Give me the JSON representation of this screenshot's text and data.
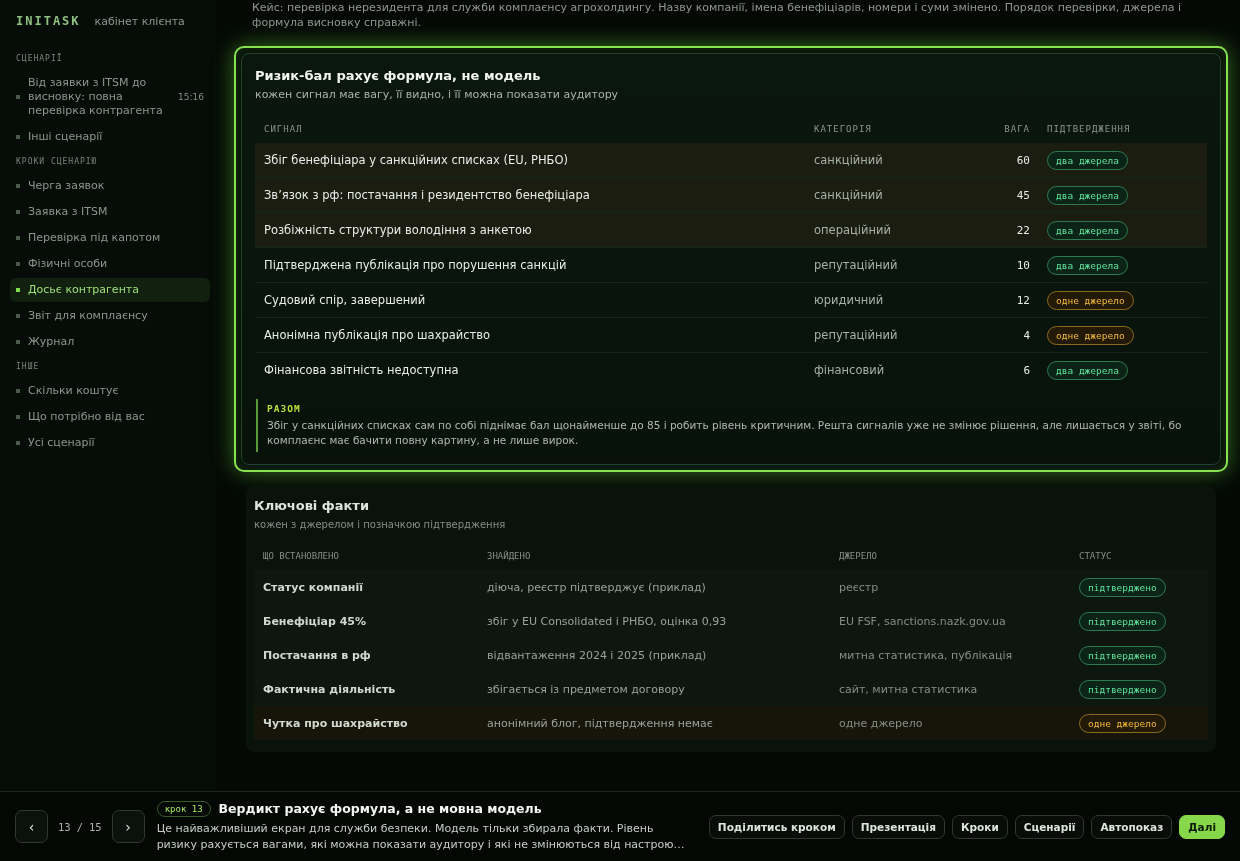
{
  "sidebar": {
    "logo": "INITASK",
    "subtitle": "кабінет клієнта",
    "sections": [
      {
        "title": "СЦЕНАРІЇ",
        "items": [
          {
            "label": "Від заявки з ITSM до висновку: повна перевірка контрагента",
            "badge": "15:16",
            "selected": false
          },
          {
            "label": "Інші сценарії",
            "selected": false
          }
        ]
      },
      {
        "title": "КРОКИ СЦЕНАРІЮ",
        "items": [
          {
            "label": "Черга заявок",
            "selected": false
          },
          {
            "label": "Заявка з ITSM",
            "selected": false
          },
          {
            "label": "Перевірка під капотом",
            "selected": false
          },
          {
            "label": "Фізичні особи",
            "selected": false
          },
          {
            "label": "Досьє контрагента",
            "selected": true
          },
          {
            "label": "Звіт для комплаєнсу",
            "selected": false
          },
          {
            "label": "Журнал",
            "selected": false
          }
        ]
      },
      {
        "title": "ІНШЕ",
        "items": [
          {
            "label": "Скільки коштує",
            "selected": false
          },
          {
            "label": "Що потрібно від вас",
            "selected": false
          },
          {
            "label": "Усі сценарії",
            "selected": false
          }
        ]
      }
    ]
  },
  "intro": "Кейс: перевірка нерезидента для служби комплаєнсу агрохолдингу. Назву компанії, імена бенефіціарів, номери і суми змінено. Порядок перевірки, джерела і формула висновку справжні.",
  "risk_card": {
    "title": "Ризик-бал рахує формула, не модель",
    "subtitle": "кожен сигнал має вагу, її видно, і її можна показати аудитору",
    "columns": [
      "СИГНАЛ",
      "КАТЕГОРІЯ",
      "ВАГА",
      "ПІДТВЕРДЖЕННЯ"
    ],
    "rows": [
      {
        "signal": "Збіг бенефіціара у санкційних списках (EU, РНБО)",
        "category": "санкційний",
        "weight": "60",
        "confirmation": "два джерела",
        "kind": "double",
        "highlighted": true
      },
      {
        "signal": "Зв’язок з рф: постачання і резидентство бенефіціара",
        "category": "санкційний",
        "weight": "45",
        "confirmation": "два джерела",
        "kind": "double",
        "highlighted": true
      },
      {
        "signal": "Розбіжність структури володіння з анкетою",
        "category": "операційний",
        "weight": "22",
        "confirmation": "два джерела",
        "kind": "double",
        "highlighted": true
      },
      {
        "signal": "Підтверджена публікація про порушення санкцій",
        "category": "репутаційний",
        "weight": "10",
        "confirmation": "два джерела",
        "kind": "double",
        "highlighted": false
      },
      {
        "signal": "Судовий спір, завершений",
        "category": "юридичний",
        "weight": "12",
        "confirmation": "одне джерело",
        "kind": "single",
        "highlighted": false
      },
      {
        "signal": "Анонімна публікація про шахрайство",
        "category": "репутаційний",
        "weight": "4",
        "confirmation": "одне джерело",
        "kind": "single",
        "highlighted": false
      },
      {
        "signal": "Фінансова звітність недоступна",
        "category": "фінансовий",
        "weight": "6",
        "confirmation": "два джерела",
        "kind": "double",
        "highlighted": false
      }
    ],
    "summary_label": "РАЗОМ",
    "summary": "Збіг у санкційних списках сам по собі піднімає бал щонайменше до 85 і робить рівень критичним. Решта сигналів уже не змінює рішення, але лишається у звіті, бо комплаєнс має бачити повну картину, а не лише вирок."
  },
  "facts_card": {
    "title": "Ключові факти",
    "subtitle": "кожен з джерелом і позначкою підтвердження",
    "columns": [
      "ЩО ВСТАНОВЛЕНО",
      "ЗНАЙДЕНО",
      "ДЖЕРЕЛО",
      "СТАТУС"
    ],
    "rows": [
      {
        "fact": "Статус компанії",
        "found": "діюча, реєстр підтверджує (приклад)",
        "source": "реєстр",
        "status": "підтверджено",
        "kind": "double"
      },
      {
        "fact": "Бенефіціар 45%",
        "found": "збіг у EU Consolidated і РНБО, оцінка 0,93",
        "source": "EU FSF, sanctions.nazk.gov.ua",
        "status": "підтверджено",
        "kind": "double"
      },
      {
        "fact": "Постачання в рф",
        "found": "відвантаження 2024 і 2025 (приклад)",
        "source": "митна статистика, публікація",
        "status": "підтверджено",
        "kind": "double"
      },
      {
        "fact": "Фактична діяльність",
        "found": "збігається із предметом договору",
        "source": "сайт, митна статистика",
        "status": "підтверджено",
        "kind": "double"
      },
      {
        "fact": "Чутка про шахрайство",
        "found": "анонімний блог, підтвердження немає",
        "source": "одне джерело",
        "status": "одне джерело",
        "kind": "single"
      }
    ]
  },
  "footer": {
    "prev": "‹",
    "current": "13",
    "separator": "/",
    "total": "15",
    "next": "›",
    "step_badge": "крок 13",
    "title": "Вердикт рахує формула, а не мовна модель",
    "description": "Це найважливіший екран для служби безпеки. Модель тільки збирала факти. Рівень ризику рахується вагами, які можна показати аудитору і які не змінюються від настрою…",
    "buttons": [
      {
        "label": "Поділитись кроком",
        "kind": "secondary"
      },
      {
        "label": "Презентація",
        "kind": "secondary"
      },
      {
        "label": "Кроки",
        "kind": "secondary"
      },
      {
        "label": "Сценарії",
        "kind": "secondary"
      },
      {
        "label": "Автопоказ",
        "kind": "secondary"
      },
      {
        "label": "Далі",
        "kind": "primary"
      }
    ]
  }
}
